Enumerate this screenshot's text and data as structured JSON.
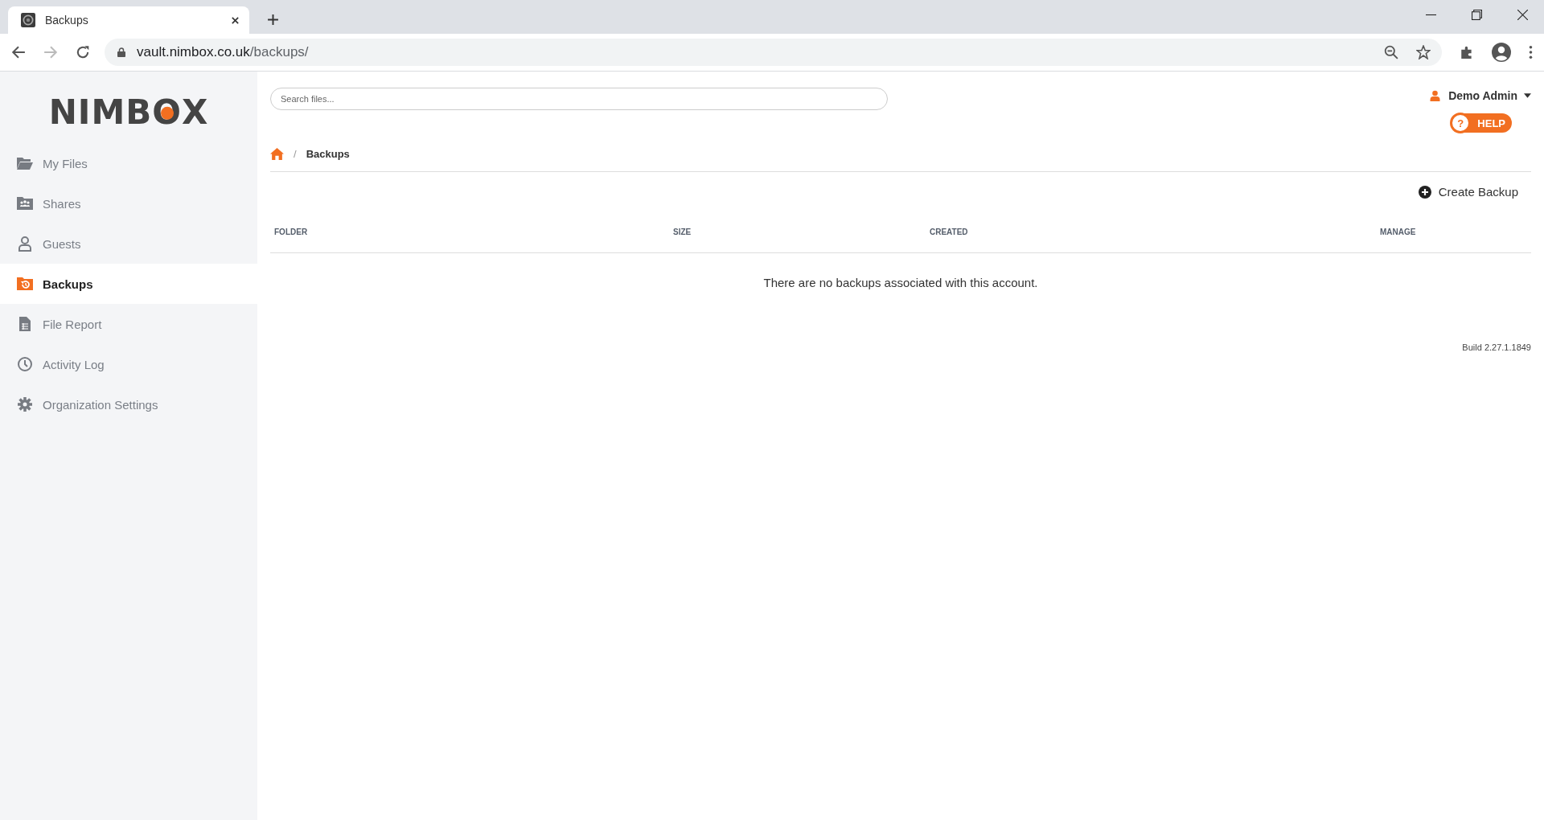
{
  "browser": {
    "tab_title": "Backups",
    "url_host": "vault.nimbox.co.uk",
    "url_path": "/backups/"
  },
  "logo": "NIMBOX",
  "sidebar": {
    "items": [
      {
        "label": "My Files",
        "kind": "folder",
        "selected": false
      },
      {
        "label": "Shares",
        "kind": "shares",
        "selected": false
      },
      {
        "label": "Guests",
        "kind": "user",
        "selected": false
      },
      {
        "label": "Backups",
        "kind": "backup",
        "selected": true
      },
      {
        "label": "File Report",
        "kind": "report",
        "selected": false
      },
      {
        "label": "Activity Log",
        "kind": "clock",
        "selected": false
      },
      {
        "label": "Organization Settings",
        "kind": "gear",
        "selected": false
      }
    ]
  },
  "search": {
    "placeholder": "Search files..."
  },
  "user": {
    "name": "Demo Admin"
  },
  "help_button": {
    "icon": "?",
    "label": "HELP"
  },
  "breadcrumb": {
    "current": "Backups",
    "separator": "/"
  },
  "create_button": "Create Backup",
  "table": {
    "columns": [
      "FOLDER",
      "SIZE",
      "CREATED",
      "MANAGE"
    ],
    "empty_message": "There are no backups associated with this account."
  },
  "build": "Build 2.27.1.1849"
}
